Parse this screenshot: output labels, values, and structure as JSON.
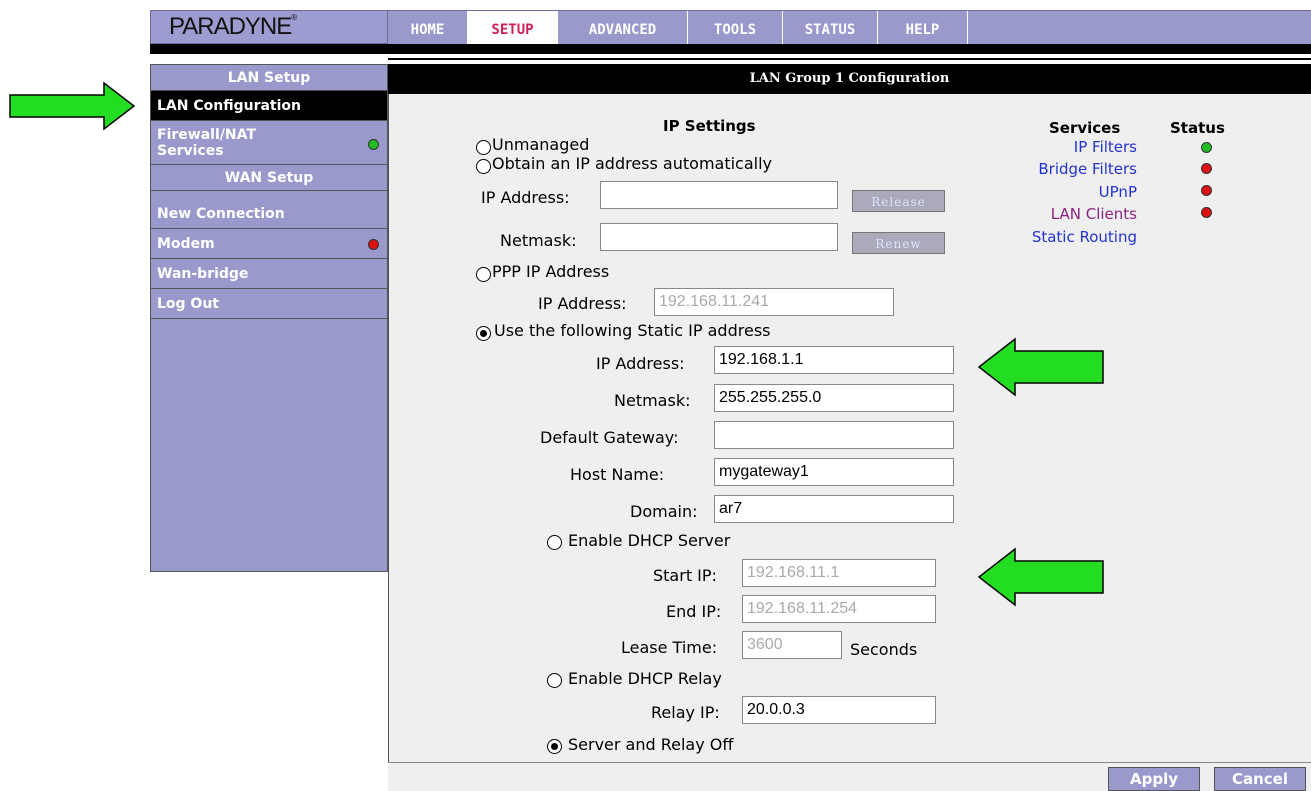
{
  "header": {
    "logo": "PARADYNE",
    "logo_mark": "®",
    "tabs": [
      "HOME",
      "SETUP",
      "ADVANCED",
      "TOOLS",
      "STATUS",
      "HELP"
    ],
    "active_tab": "SETUP"
  },
  "sidebar": {
    "lan_header": "LAN Setup",
    "lan_configuration": "LAN Configuration",
    "firewall_nat": "Firewall/NAT",
    "services": "Services",
    "wan_header": "WAN Setup",
    "new_connection": "New Connection",
    "modem": "Modem",
    "wan_bridge": "Wan-bridge",
    "log_out": "Log Out"
  },
  "main": {
    "title": "LAN Group 1 Configuration",
    "ip_settings_heading": "IP Settings",
    "unmanaged": "Unmanaged",
    "obtain_auto": "Obtain an IP address automatically",
    "auto_ip_label": "IP Address:",
    "auto_netmask_label": "Netmask:",
    "release_button": "Release",
    "renew_button": "Renew",
    "ppp_ip": "PPP IP Address",
    "ppp_ip_label": "IP Address:",
    "ppp_ip_value": "192.168.11.241",
    "use_static": "Use the following Static IP address",
    "static_ip_label": "IP Address:",
    "static_ip_value": "192.168.1.1",
    "static_netmask_label": "Netmask:",
    "static_netmask_value": "255.255.255.0",
    "gateway_label": "Default Gateway:",
    "gateway_value": "",
    "host_label": "Host Name:",
    "host_value": "mygateway1",
    "domain_label": "Domain:",
    "domain_value": "ar7",
    "enable_dhcp_server": "Enable DHCP Server",
    "start_ip_label": "Start IP:",
    "start_ip_value": "192.168.11.1",
    "end_ip_label": "End IP:",
    "end_ip_value": "192.168.11.254",
    "lease_label": "Lease Time:",
    "lease_value": "3600",
    "seconds": "Seconds",
    "enable_dhcp_relay": "Enable DHCP Relay",
    "relay_label": "Relay IP:",
    "relay_value": "20.0.0.3",
    "server_relay_off": "Server and Relay Off"
  },
  "services_panel": {
    "services_heading": "Services",
    "status_heading": "Status",
    "ip_filters": "IP Filters",
    "bridge_filters": "Bridge Filters",
    "upnp": "UPnP",
    "lan_clients": "LAN Clients",
    "static_routing": "Static Routing"
  },
  "footer": {
    "apply": "Apply",
    "cancel": "Cancel"
  },
  "colors": {
    "nav_bg": "#9999cc",
    "active_tab_text": "#cc2255",
    "status_green": "#22bb22",
    "status_red": "#dd1111",
    "link_blue": "#2233cc",
    "link_visited": "#8a2380",
    "arrow_green": "#22dd22"
  }
}
